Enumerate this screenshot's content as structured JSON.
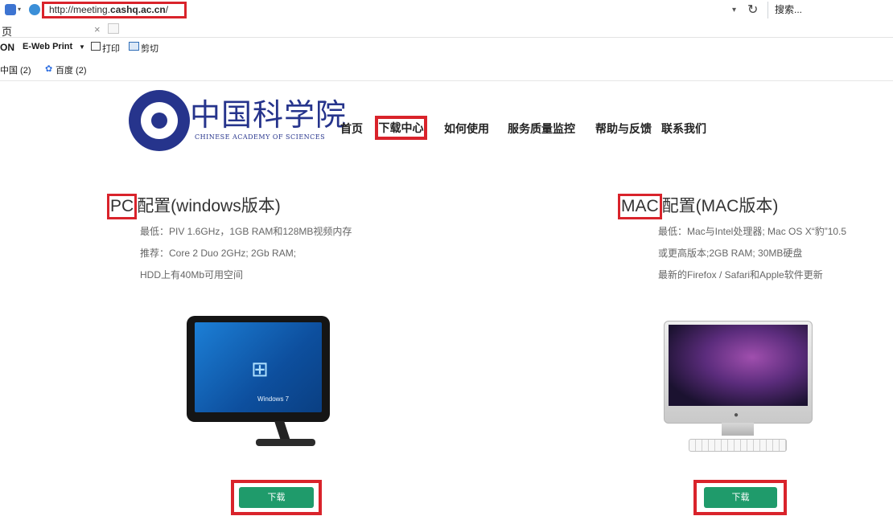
{
  "browser": {
    "url_prefix": "http://meeting.",
    "url_host": "cashq.ac.cn",
    "url_suffix": "/",
    "search_placeholder": "搜索...",
    "tab_title": "页",
    "tab_close": "×",
    "command_bar": {
      "on_label": "ON",
      "eweb_label": "E-Web Print",
      "print_label": "打印",
      "cut_label": "剪切"
    },
    "favorites": [
      {
        "label": "中国 (2)"
      },
      {
        "label": "百度 (2)"
      }
    ]
  },
  "site": {
    "logo_cn": "中国科学院",
    "logo_en": "CHINESE ACADEMY OF SCIENCES",
    "nav": [
      {
        "label": "首页"
      },
      {
        "label": "下载中心",
        "highlighted": true
      },
      {
        "label": "如何使用"
      },
      {
        "label": "服务质量监控"
      },
      {
        "label": "帮助与反馈"
      },
      {
        "label": "联系我们"
      }
    ]
  },
  "pc": {
    "title_highlight": "PC",
    "title_rest": "配置(windows版本)",
    "min_spec": "最低：PIV 1.6GHz，1GB RAM和128MB视频内存",
    "rec_spec": "推荐：Core 2 Duo 2GHz; 2Gb RAM;",
    "hdd_spec": "HDD上有40Mb可用空间",
    "screen_label": "Windows 7",
    "download_label": "下载"
  },
  "mac": {
    "title_highlight": "MAC",
    "title_rest": "配置(MAC版本)",
    "min_spec": "最低：Mac与Intel处理器; Mac OS X“豹”10.5",
    "version_spec": "或更高版本;2GB RAM; 30MB硬盘",
    "update_spec": "最新的Firefox / Safari和Apple软件更新",
    "download_label": "下载"
  },
  "colors": {
    "highlight_border": "#d9232b",
    "download_button": "#1f9b6b",
    "logo_blue": "#26348c"
  }
}
